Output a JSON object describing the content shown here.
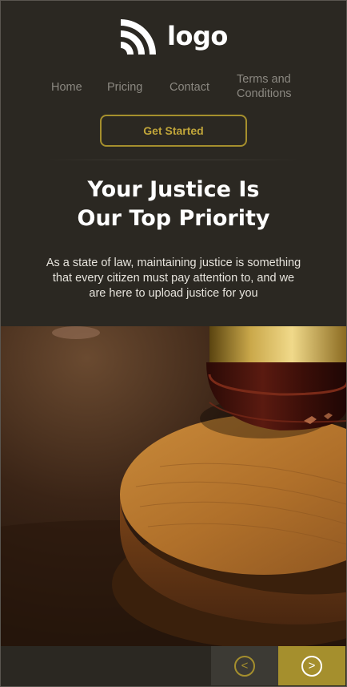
{
  "brand": {
    "logo_text": "logo",
    "logo_icon": "rss-arcs-icon"
  },
  "nav": {
    "items": [
      {
        "label": "Home"
      },
      {
        "label": "Pricing"
      },
      {
        "label": "Contact"
      },
      {
        "label": "Terms and Conditions"
      }
    ]
  },
  "cta": {
    "label": "Get Started"
  },
  "hero": {
    "headline_line1": "Your Justice Is",
    "headline_line2": "Our Top Priority",
    "description": "As a state of law, maintaining justice is something that every citizen must pay attention to, and we are here to upload justice for you",
    "image_subject": "judge gavel on wooden sound block"
  },
  "slider": {
    "prev_symbol": "<",
    "next_symbol": ">"
  },
  "colors": {
    "background": "#2b2822",
    "accent": "#a58f2d",
    "nav_text": "#8b8881",
    "prev_bg": "#3c3a34"
  }
}
